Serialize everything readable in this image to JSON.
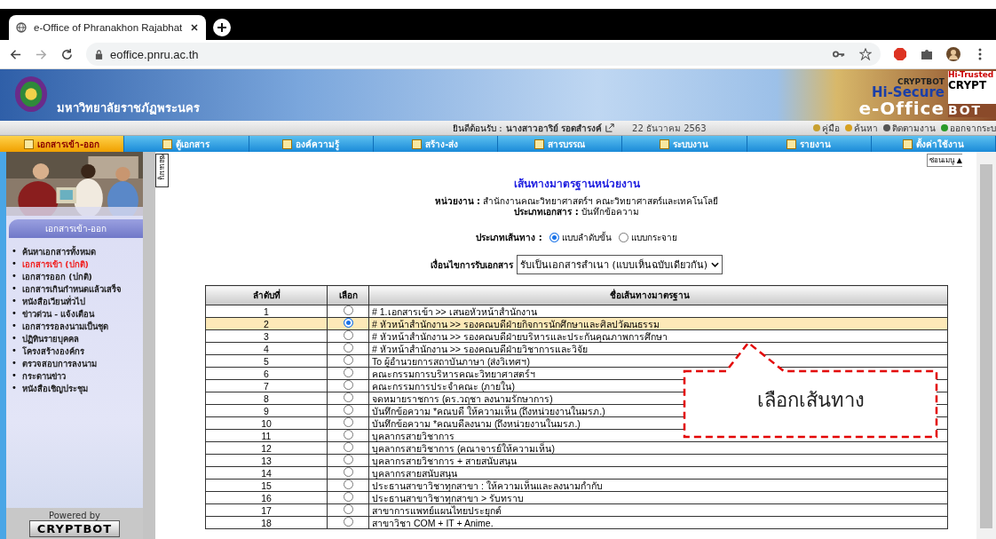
{
  "browser": {
    "tab_title": "e-Office of Phranakhon Rajabhat",
    "url": "eoffice.pnru.ac.th"
  },
  "banner": {
    "university_name": "มหาวิทยาลัยราชภัฏพระนคร",
    "brand_top": "CRYPTBOT",
    "brand_secure": "Hi-Secure",
    "brand_office": "e-Office",
    "brand_trusted": "Hi-Trusted",
    "brand_crypt": "CRYPT",
    "brand_bot": "BOT"
  },
  "info_bar": {
    "welcome": "ยินดีต้อนรับ :",
    "user": "นางสาวอาริย์ รอดสำรงค์",
    "date": "22 ธันวาคม 2563",
    "links": [
      "คู่มือ",
      "ค้นหา",
      "ติดตามงาน",
      "ออกจากระบ"
    ]
  },
  "nav": [
    {
      "label": "เอกสารเข้า-ออก",
      "selected": true
    },
    {
      "label": "ตู้เอกสาร",
      "selected": false
    },
    {
      "label": "องค์ความรู้",
      "selected": false
    },
    {
      "label": "สร้าง-ส่ง",
      "selected": false
    },
    {
      "label": "สารบรรณ",
      "selected": false
    },
    {
      "label": "ระบบงาน",
      "selected": false
    },
    {
      "label": "รายงาน",
      "selected": false
    },
    {
      "label": "ตั้งค่าใช้งาน",
      "selected": false
    }
  ],
  "sidebar": {
    "header": "เอกสารเข้า-ออก",
    "bullet": "•",
    "hide_tab": "ซ่อนเมนู",
    "items": [
      {
        "label": "ค้นหาเอกสารทั้งหมด",
        "selected": false
      },
      {
        "label": "เอกสารเข้า (ปกติ)",
        "selected": true
      },
      {
        "label": "เอกสารออก (ปกติ)",
        "selected": false
      },
      {
        "label": "เอกสารเกินกำหนดแล้วเสร็จ",
        "selected": false
      },
      {
        "label": "หนังสือเวียนทั่วไป",
        "selected": false
      },
      {
        "label": "ข่าวด่วน - แจ้งเตือน",
        "selected": false
      },
      {
        "label": "เอกสารรอลงนามเป็นชุด",
        "selected": false
      },
      {
        "label": "ปฏิทินรายบุคคล",
        "selected": false
      },
      {
        "label": "โครงสร้างองค์กร",
        "selected": false
      },
      {
        "label": "ตรวจสอบการลงนาม",
        "selected": false
      },
      {
        "label": "กระดานข่าว",
        "selected": false
      },
      {
        "label": "หนังสือเชิญประชุม",
        "selected": false
      }
    ],
    "powered_by": "Powered by",
    "brand": "CRYPTBOT"
  },
  "main": {
    "hide_menu": "ซ่อนเมนู ▲",
    "title": "เส้นทางมาตรฐานหน่วยงาน",
    "unit_label": "หน่วยงาน :",
    "unit_value": "สำนักงานคณะวิทยาศาสตร์ฯ คณะวิทยาศาสตร์และเทคโนโลยี",
    "doc_type_label": "ประเภทเอกสาร :",
    "doc_type_value": "บันทึกข้อความ",
    "route_type_label": "ประเภทเส้นทาง :",
    "route_options": [
      {
        "label": "แบบลำดับขั้น",
        "selected": true
      },
      {
        "label": "แบบกระจาย",
        "selected": false
      }
    ],
    "condition_label": "เงื่อนไขการรับเอกสาร",
    "condition_value": "รับเป็นเอกสารสำเนา (แบบเห็นฉบับเดียวกัน)",
    "columns": [
      "ลำดับที่",
      "เลือก",
      "ชื่อเส้นทางมาตรฐาน"
    ],
    "rows": [
      {
        "no": "1",
        "name": "# 1.เอกสารเข้า >> เสนอหัวหน้าสำนักงาน",
        "selected": false
      },
      {
        "no": "2",
        "name": "# หัวหน้าสำนักงาน >> รองคณบดีฝ่ายกิจการนักศึกษาและศิลปวัฒนธรรม",
        "selected": true
      },
      {
        "no": "3",
        "name": "# หัวหน้าสำนักงาน >> รองคณบดีฝ่ายบริหารและประกันคุณภาพการศึกษา",
        "selected": false
      },
      {
        "no": "4",
        "name": "# หัวหน้าสำนักงาน >> รองคณบดีฝ่ายวิชาการและวิจัย",
        "selected": false
      },
      {
        "no": "5",
        "name": "To ผู้อำนวยการสถาบันภาษา (ส่งวิเทศฯ)",
        "selected": false
      },
      {
        "no": "6",
        "name": "คณะกรรมการบริหารคณะวิทยาศาสตร์ฯ",
        "selected": false
      },
      {
        "no": "7",
        "name": "คณะกรรมการประจำคณะ (ภายใน)",
        "selected": false
      },
      {
        "no": "8",
        "name": "จดหมายราชการ (ดร.วฤชา ลงนามรักษาการ)",
        "selected": false
      },
      {
        "no": "9",
        "name": "บันทึกข้อความ *คณบดี ให้ความเห็น (ถึงหน่วยงานในมรภ.)",
        "selected": false
      },
      {
        "no": "10",
        "name": "บันทึกข้อความ *คณบดีลงนาม (ถึงหน่วยงานในมรภ.)",
        "selected": false
      },
      {
        "no": "11",
        "name": "บุคลากรสายวิชาการ",
        "selected": false
      },
      {
        "no": "12",
        "name": "บุคลากรสายวิชาการ (คณาจารย์ให้ความเห็น)",
        "selected": false
      },
      {
        "no": "13",
        "name": "บุคลากรสายวิชาการ + สายสนับสนุน",
        "selected": false
      },
      {
        "no": "14",
        "name": "บุคลากรสายสนับสนุน",
        "selected": false
      },
      {
        "no": "15",
        "name": "ประธานสาขาวิชาทุกสาขา : ให้ความเห็นและลงนามกำกับ",
        "selected": false
      },
      {
        "no": "16",
        "name": "ประธานสาขาวิชาทุกสาขา > รับทราบ",
        "selected": false
      },
      {
        "no": "17",
        "name": "สาขาการแพทย์แผนไทยประยุกต์",
        "selected": false
      },
      {
        "no": "18",
        "name": "สาขาวิชา COM + IT + Anime.",
        "selected": false
      }
    ]
  },
  "callout": {
    "text": "เลือกเส้นทาง"
  }
}
